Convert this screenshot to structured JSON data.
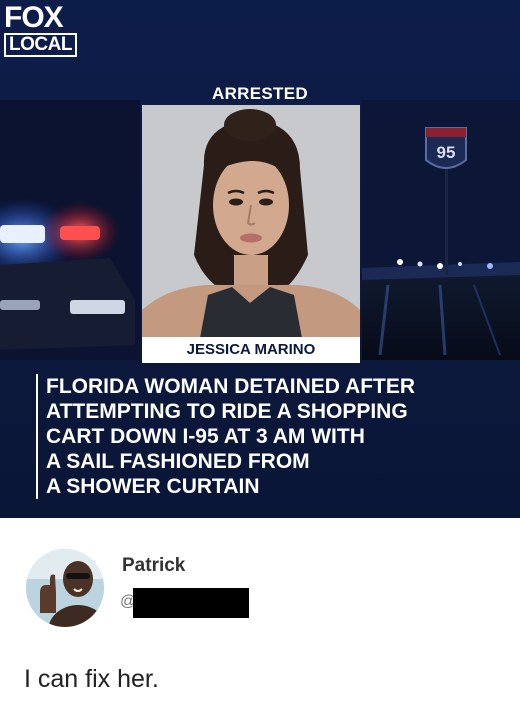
{
  "news": {
    "logo_line1": "FOX",
    "logo_line2": "LOCAL",
    "label": "ARRESTED",
    "highway_sign": "95",
    "name": "JESSICA MARINO",
    "headline_lines": [
      "FLORIDA WOMAN DETAINED AFTER",
      "ATTEMPTING TO RIDE A SHOPPING",
      "CART DOWN I-95 AT 3 AM WITH",
      "A SAIL FASHIONED FROM",
      "A SHOWER CURTAIN"
    ]
  },
  "post": {
    "user_name": "Patrick",
    "handle_prefix": "@",
    "text": "I can fix her."
  },
  "colors": {
    "banner": "#0d1f4a",
    "police_red": "#e0242e",
    "police_blue": "#2f7bff"
  }
}
